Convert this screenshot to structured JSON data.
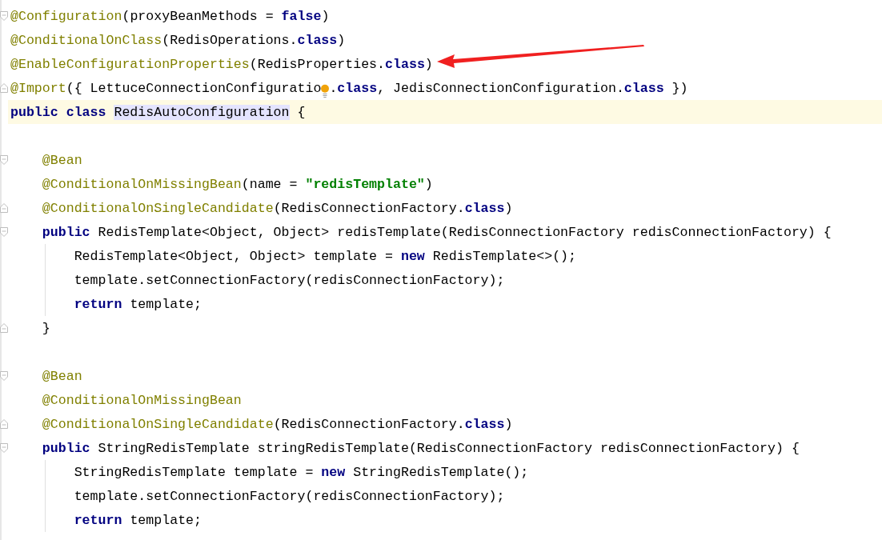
{
  "editor": {
    "lines": [
      {
        "current": false,
        "fold_start": true,
        "tokens": [
          {
            "kind": "annotation",
            "text": "@Configuration"
          },
          {
            "kind": "plain",
            "text": "(proxyBeanMethods = "
          },
          {
            "kind": "keyword",
            "text": "false"
          },
          {
            "kind": "plain",
            "text": ")"
          }
        ]
      },
      {
        "current": false,
        "tokens": [
          {
            "kind": "annotation",
            "text": "@ConditionalOnClass"
          },
          {
            "kind": "plain",
            "text": "(RedisOperations."
          },
          {
            "kind": "keyword",
            "text": "class"
          },
          {
            "kind": "plain",
            "text": ")"
          }
        ]
      },
      {
        "current": false,
        "tokens": [
          {
            "kind": "annotation",
            "text": "@EnableConfigurationProperties"
          },
          {
            "kind": "plain",
            "text": "(RedisProperties."
          },
          {
            "kind": "keyword",
            "text": "class"
          },
          {
            "kind": "plain",
            "text": ")"
          }
        ]
      },
      {
        "current": false,
        "fold_end": true,
        "tokens": [
          {
            "kind": "annotation",
            "text": "@Import"
          },
          {
            "kind": "plain",
            "text": "({ LettuceConnectionConfiguratio"
          },
          {
            "kind": "bulb"
          },
          {
            "kind": "plain",
            "text": "."
          },
          {
            "kind": "keyword",
            "text": "class"
          },
          {
            "kind": "plain",
            "text": ", JedisConnectionConfiguration."
          },
          {
            "kind": "keyword",
            "text": "class"
          },
          {
            "kind": "plain",
            "text": " })"
          }
        ]
      },
      {
        "current": true,
        "tokens": [
          {
            "kind": "keyword",
            "text": "public class "
          },
          {
            "kind": "usage",
            "text": "RedisAutoConfiguration"
          },
          {
            "kind": "plain",
            "text": " {"
          }
        ]
      },
      {
        "current": false
      },
      {
        "current": false,
        "fold_start": true,
        "tokens": [
          {
            "kind": "annotation",
            "text": "    @Bean"
          }
        ]
      },
      {
        "current": false,
        "tokens": [
          {
            "kind": "annotation",
            "text": "    @ConditionalOnMissingBean"
          },
          {
            "kind": "plain",
            "text": "(name = "
          },
          {
            "kind": "string",
            "text": "\"redisTemplate\""
          },
          {
            "kind": "plain",
            "text": ")"
          }
        ]
      },
      {
        "current": false,
        "fold_end": true,
        "tokens": [
          {
            "kind": "annotation",
            "text": "    @ConditionalOnSingleCandidate"
          },
          {
            "kind": "plain",
            "text": "(RedisConnectionFactory."
          },
          {
            "kind": "keyword",
            "text": "class"
          },
          {
            "kind": "plain",
            "text": ")"
          }
        ]
      },
      {
        "current": false,
        "fold_start": true,
        "tokens": [
          {
            "kind": "keyword",
            "text": "    public"
          },
          {
            "kind": "plain",
            "text": " RedisTemplate<Object, Object> redisTemplate(RedisConnectionFactory redisConnectionFactory) {"
          }
        ]
      },
      {
        "current": false,
        "guide": true,
        "tokens": [
          {
            "kind": "plain",
            "text": "        RedisTemplate<Object, Object> template = "
          },
          {
            "kind": "keyword",
            "text": "new"
          },
          {
            "kind": "plain",
            "text": " RedisTemplate<>();"
          }
        ]
      },
      {
        "current": false,
        "guide": true,
        "tokens": [
          {
            "kind": "plain",
            "text": "        template.setConnectionFactory(redisConnectionFactory);"
          }
        ]
      },
      {
        "current": false,
        "guide": true,
        "tokens": [
          {
            "kind": "keyword",
            "text": "        return"
          },
          {
            "kind": "plain",
            "text": " template;"
          }
        ]
      },
      {
        "current": false,
        "fold_end": true,
        "tokens": [
          {
            "kind": "plain",
            "text": "    }"
          }
        ]
      },
      {
        "current": false
      },
      {
        "current": false,
        "fold_start": true,
        "tokens": [
          {
            "kind": "annotation",
            "text": "    @Bean"
          }
        ]
      },
      {
        "current": false,
        "tokens": [
          {
            "kind": "annotation",
            "text": "    @ConditionalOnMissingBean"
          }
        ]
      },
      {
        "current": false,
        "fold_end": true,
        "tokens": [
          {
            "kind": "annotation",
            "text": "    @ConditionalOnSingleCandidate"
          },
          {
            "kind": "plain",
            "text": "(RedisConnectionFactory."
          },
          {
            "kind": "keyword",
            "text": "class"
          },
          {
            "kind": "plain",
            "text": ")"
          }
        ]
      },
      {
        "current": false,
        "fold_start": true,
        "tokens": [
          {
            "kind": "keyword",
            "text": "    public"
          },
          {
            "kind": "plain",
            "text": " StringRedisTemplate stringRedisTemplate(RedisConnectionFactory redisConnectionFactory) {"
          }
        ]
      },
      {
        "current": false,
        "guide": true,
        "tokens": [
          {
            "kind": "plain",
            "text": "        StringRedisTemplate template = "
          },
          {
            "kind": "keyword",
            "text": "new"
          },
          {
            "kind": "plain",
            "text": " StringRedisTemplate();"
          }
        ]
      },
      {
        "current": false,
        "guide": true,
        "tokens": [
          {
            "kind": "plain",
            "text": "        template.setConnectionFactory(redisConnectionFactory);"
          }
        ]
      },
      {
        "current": false,
        "guide": true,
        "tokens": [
          {
            "kind": "keyword",
            "text": "        return"
          },
          {
            "kind": "plain",
            "text": " template;"
          }
        ]
      }
    ]
  }
}
